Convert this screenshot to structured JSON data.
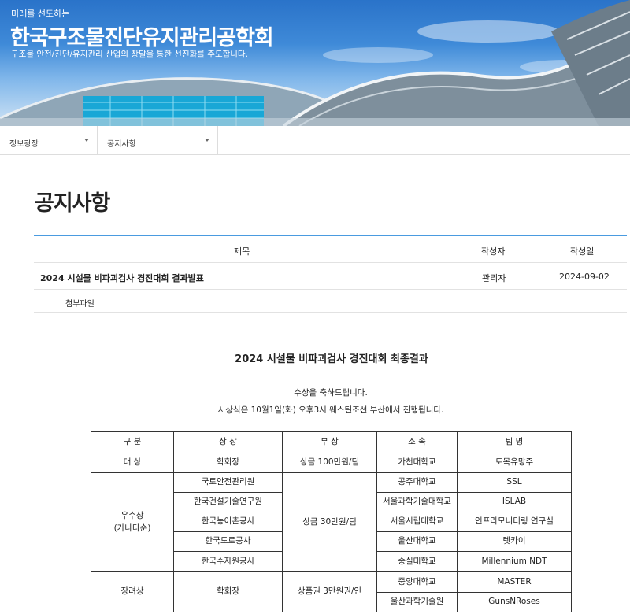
{
  "header": {
    "tagline": "미래를 선도하는",
    "title": "한국구조물진단유지관리공학회",
    "subtitle": "구조물 안전/진단/유지관리 산업의 창달을 통한 선진화를 주도합니다."
  },
  "breadcrumb": {
    "section": "정보광장",
    "page": "공지사항"
  },
  "page_title": "공지사항",
  "notice": {
    "col_title": "제목",
    "col_author": "작성자",
    "col_date": "작성일",
    "title": "2024 시설물 비파괴검사 경진대회 결과발표",
    "author": "관리자",
    "date": "2024-09-02",
    "attachment_label": "첨부파일"
  },
  "content": {
    "heading": "2024 시설물 비파괴검사 경진대회 최종결과",
    "congrats": "수상을 축하드립니다.",
    "ceremony": "시상식은 10월1일(화) 오후3시 웨스틴조선 부산에서 진행됩니다."
  },
  "results": {
    "headers": [
      "구 분",
      "상 장",
      "부 상",
      "소 속",
      "팀 명"
    ],
    "grand": {
      "category": "대 상",
      "certificate": "학회장",
      "prize": "상금 100만원/팀",
      "school": "가천대학교",
      "team": "토목유망주"
    },
    "excellence": {
      "category_line1": "우수상",
      "category_line2": "(가나다순)",
      "prize": "상금 30만원/팀",
      "rows": [
        {
          "certificate": "국토안전관리원",
          "school": "공주대학교",
          "team": "SSL"
        },
        {
          "certificate": "한국건설기술연구원",
          "school": "서울과학기술대학교",
          "team": "ISLAB"
        },
        {
          "certificate": "한국농어촌공사",
          "school": "서울시립대학교",
          "team": "인프라모니터링 연구실"
        },
        {
          "certificate": "한국도로공사",
          "school": "울산대학교",
          "team": "텟카이"
        },
        {
          "certificate": "한국수자원공사",
          "school": "숭실대학교",
          "team": "Millennium NDT"
        }
      ]
    },
    "encouragement": {
      "category": "장려상",
      "certificate": "학회장",
      "prize": "상품권 3만원권/인",
      "rows": [
        {
          "school": "중앙대학교",
          "team": "MASTER"
        },
        {
          "school": "울산과학기술원",
          "team": "GunsNRoses"
        }
      ]
    }
  }
}
